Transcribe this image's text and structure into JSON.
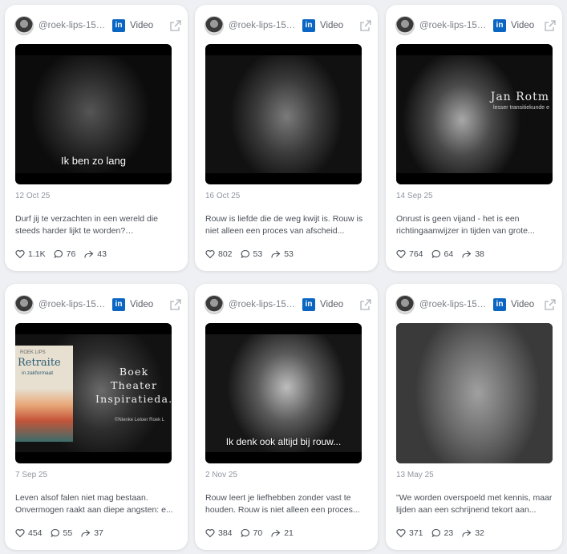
{
  "cards": [
    {
      "handle": "@roek-lips-15a...",
      "media_label": "Video",
      "date": "12 Oct 25",
      "text": "Durf jij te verzachten in een wereld die steeds harder lijkt te worden? Verzachting...",
      "likes": "1.1K",
      "comments": "76",
      "shares": "43",
      "overlay": "Ik ben zo lang"
    },
    {
      "handle": "@roek-lips-15a...",
      "media_label": "Video",
      "date": "16 Oct 25",
      "text": "Rouw is liefde die de weg kwijt is. Rouw is niet alleen een proces van afscheid...",
      "likes": "802",
      "comments": "53",
      "shares": "53"
    },
    {
      "handle": "@roek-lips-15a...",
      "media_label": "Video",
      "date": "14 Sep 25",
      "text": "Onrust is geen vijand - het is een richtingaanwijzer in tijden van grote...",
      "likes": "764",
      "comments": "64",
      "shares": "38",
      "overlay_name": "Jan Rotm",
      "overlay_role": "lesser transitiekunde e"
    },
    {
      "handle": "@roek-lips-15a...",
      "media_label": "Video",
      "date": "7 Sep 25",
      "text": "Leven alsof falen niet mag bestaan. Onvermogen raakt aan diepe angsten: e...",
      "likes": "454",
      "comments": "55",
      "shares": "37",
      "book_author": "ROEK LIPS",
      "book_title": "Retraite",
      "book_sub": "in zakformaat",
      "overlay_l1": "Boek",
      "overlay_l2": "Theater",
      "overlay_l3": "Inspiratieda.",
      "overlay_credit": "©Nienke Leloer Roek L"
    },
    {
      "handle": "@roek-lips-15a...",
      "media_label": "Video",
      "date": "2 Nov 25",
      "text": "Rouw leert je liefhebben zonder vast te houden. Rouw is niet alleen een proces...",
      "likes": "384",
      "comments": "70",
      "shares": "21",
      "overlay": "Ik denk ook altijd bij rouw..."
    },
    {
      "handle": "@roek-lips-15a...",
      "media_label": "Video",
      "date": "13 May 25",
      "text": "\"We worden overspoeld met kennis, maar lijden aan een schrijnend tekort aan...",
      "likes": "371",
      "comments": "23",
      "shares": "32"
    }
  ],
  "colors": {
    "linkedin": "#0a66c2",
    "card_bg": "#ffffff",
    "page_bg": "#eef0f3"
  },
  "icons": [
    "linkedin-icon",
    "external-link-icon",
    "heart-icon",
    "comment-icon",
    "share-icon"
  ]
}
